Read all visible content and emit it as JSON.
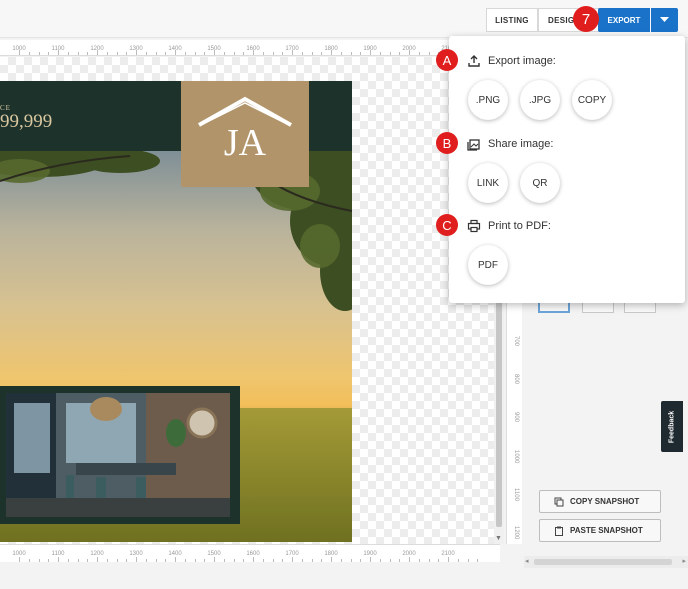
{
  "toolbar": {
    "tab_listing": "LISTING",
    "tab_design": "DESIGN",
    "export_label": "EXPORT"
  },
  "flyer": {
    "price_label": "CE",
    "price_value": "99,999",
    "logo_text": "JA"
  },
  "rulers": {
    "top": [
      "1000",
      "1100",
      "1200",
      "1300",
      "1400",
      "1500",
      "1600",
      "1700",
      "1800",
      "1900",
      "2000",
      "2100"
    ],
    "bottom": [
      "1000",
      "1100",
      "1200",
      "1300",
      "1400",
      "1500",
      "1600",
      "1700",
      "1800",
      "1900",
      "2000",
      "2100"
    ],
    "right": [
      "700",
      "800",
      "900",
      "1000",
      "1100",
      "1200"
    ]
  },
  "export_menu": {
    "sections": [
      {
        "badge": "A",
        "icon": "upload-icon",
        "title": "Export image:",
        "buttons": [
          ".PNG",
          ".JPG",
          "COPY"
        ]
      },
      {
        "badge": "B",
        "icon": "image-icon",
        "title": "Share image:",
        "buttons": [
          "LINK",
          "QR"
        ]
      },
      {
        "badge": "C",
        "icon": "printer-icon",
        "title": "Print to PDF:",
        "buttons": [
          "PDF"
        ]
      }
    ],
    "step_badge": "7"
  },
  "side_panel": {
    "copy_snapshot": "COPY SNAPSHOT",
    "paste_snapshot": "PASTE SNAPSHOT",
    "feedback": "Feedback"
  },
  "colors": {
    "accent": "#1a73c8",
    "badge": "#e01e1e",
    "flyer_green": "#1d322b",
    "flyer_gold": "#b1946a"
  }
}
